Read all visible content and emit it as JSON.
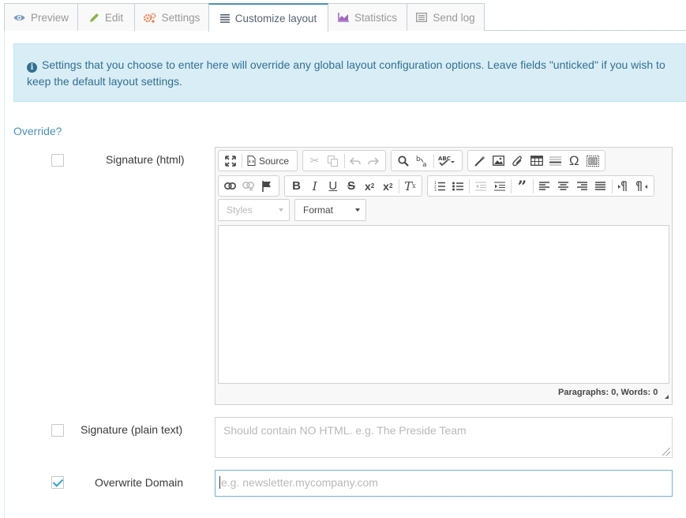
{
  "tabs": [
    {
      "label": "Preview",
      "icon": "eye-icon",
      "icon_color": "#7d9bc0"
    },
    {
      "label": "Edit",
      "icon": "pencil-icon",
      "icon_color": "#8bb44c"
    },
    {
      "label": "Settings",
      "icon": "cogs-icon",
      "icon_color": "#e8875b"
    },
    {
      "label": "Customize layout",
      "icon": "list-icon",
      "icon_color": "#576373",
      "active": true
    },
    {
      "label": "Statistics",
      "icon": "area-chart-icon",
      "icon_color": "#a069c3"
    },
    {
      "label": "Send log",
      "icon": "list-alt-icon",
      "icon_color": "#999999"
    }
  ],
  "alert": {
    "line1": "Settings that you choose to enter here will override any global layout configuration options. Leave fields \"unticked\" if you wish to",
    "line2": "keep the default layout settings."
  },
  "override_label": "Override?",
  "fields": {
    "signature_html": {
      "label": "Signature (html)",
      "checked": false
    },
    "signature_plain": {
      "label": "Signature (plain text)",
      "checked": false,
      "placeholder": "Should contain NO HTML. e.g. The Preside Team"
    },
    "overwrite_domain": {
      "label": "Overwrite Domain",
      "checked": true,
      "placeholder": "e.g. newsletter.mycompany.com"
    }
  },
  "editor": {
    "source_label": "Source",
    "styles_label": "Styles",
    "format_label": "Format",
    "status": "Paragraphs: 0, Words: 0"
  },
  "colors": {
    "accent": "#4c8fbd",
    "alert_bg": "#d9edf7",
    "alert_text": "#31708f",
    "check": "#32a3ce"
  }
}
